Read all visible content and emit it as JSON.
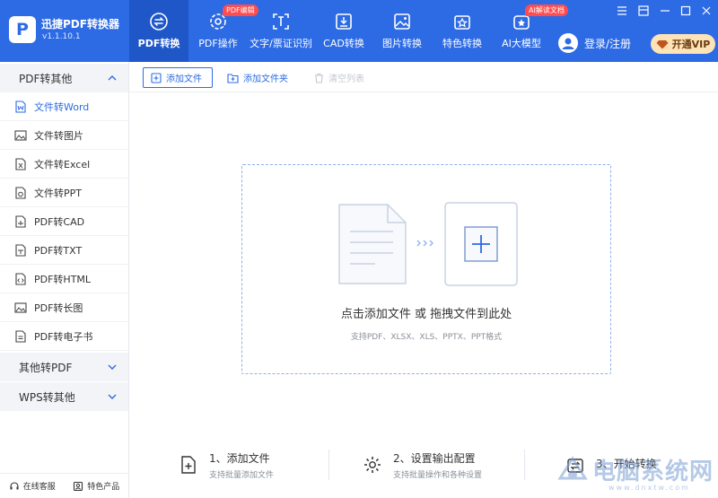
{
  "app": {
    "title": "迅捷PDF转换器",
    "version": "v1.1.10.1",
    "logo_letter": "P"
  },
  "nav": {
    "tabs": [
      {
        "label": "PDF转换",
        "icon": "convert-icon",
        "active": true
      },
      {
        "label": "PDF操作",
        "icon": "settings-icon",
        "badge": "PDF编辑"
      },
      {
        "label": "文字/票证识别",
        "icon": "scan-icon"
      },
      {
        "label": "CAD转换",
        "icon": "cad-icon"
      },
      {
        "label": "图片转换",
        "icon": "image-icon"
      },
      {
        "label": "特色转换",
        "icon": "feature-icon"
      },
      {
        "label": "AI大模型",
        "icon": "ai-icon",
        "badge": "AI解读文档"
      }
    ],
    "login_label": "登录/注册",
    "vip_label": "开通VIP"
  },
  "sidebar": {
    "groups": [
      {
        "label": "PDF转其他",
        "expanded": true
      },
      {
        "label": "其他转PDF",
        "expanded": false
      },
      {
        "label": "WPS转其他",
        "expanded": false
      }
    ],
    "items": [
      {
        "label": "文件转Word",
        "icon": "word-icon",
        "active": true
      },
      {
        "label": "文件转图片",
        "icon": "image-icon"
      },
      {
        "label": "文件转Excel",
        "icon": "excel-icon"
      },
      {
        "label": "文件转PPT",
        "icon": "ppt-icon"
      },
      {
        "label": "PDF转CAD",
        "icon": "cad-icon"
      },
      {
        "label": "PDF转TXT",
        "icon": "txt-icon"
      },
      {
        "label": "PDF转HTML",
        "icon": "html-icon"
      },
      {
        "label": "PDF转长图",
        "icon": "long-image-icon"
      },
      {
        "label": "PDF转电子书",
        "icon": "ebook-icon"
      }
    ],
    "footer": {
      "service": "在线客服",
      "features": "特色产品"
    }
  },
  "toolbar": {
    "add_file": "添加文件",
    "add_folder": "添加文件夹",
    "clear_list": "清空列表"
  },
  "dropzone": {
    "title": "点击添加文件 或 拖拽文件到此处",
    "formats": "支持PDF、XLSX、XLS、PPTX、PPT格式"
  },
  "steps": [
    {
      "title": "1、添加文件",
      "sub": "支持批量添加文件"
    },
    {
      "title": "2、设置输出配置",
      "sub": "支持批量操作和各种设置"
    },
    {
      "title": "3、开始转换",
      "sub": ""
    }
  ],
  "watermark": {
    "text": "电脑系统网",
    "url": "www.dnxtw.com"
  },
  "colors": {
    "brand": "#2d6be4",
    "brand_dark": "#1f57c9",
    "badge": "#ff4d4f",
    "vip_bg": "#fde3b6"
  }
}
